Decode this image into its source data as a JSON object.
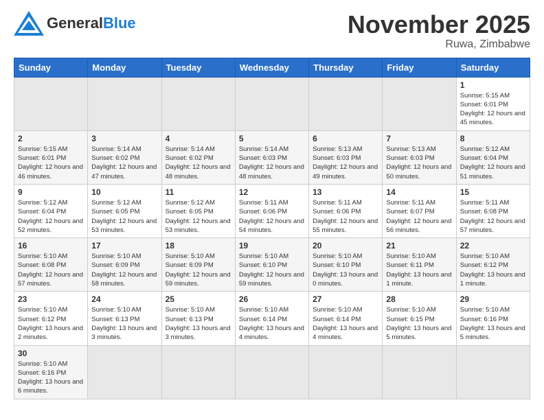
{
  "header": {
    "logo_general": "General",
    "logo_blue": "Blue",
    "month_title": "November 2025",
    "location": "Ruwa, Zimbabwe"
  },
  "weekdays": [
    "Sunday",
    "Monday",
    "Tuesday",
    "Wednesday",
    "Thursday",
    "Friday",
    "Saturday"
  ],
  "weeks": [
    {
      "days": [
        {
          "num": "",
          "empty": true
        },
        {
          "num": "",
          "empty": true
        },
        {
          "num": "",
          "empty": true
        },
        {
          "num": "",
          "empty": true
        },
        {
          "num": "",
          "empty": true
        },
        {
          "num": "",
          "empty": true
        },
        {
          "num": "1",
          "sunrise": "5:15 AM",
          "sunset": "6:01 PM",
          "daylight": "12 hours and 45 minutes."
        }
      ]
    },
    {
      "days": [
        {
          "num": "2",
          "sunrise": "5:15 AM",
          "sunset": "6:01 PM",
          "daylight": "12 hours and 46 minutes."
        },
        {
          "num": "3",
          "sunrise": "5:14 AM",
          "sunset": "6:02 PM",
          "daylight": "12 hours and 47 minutes."
        },
        {
          "num": "4",
          "sunrise": "5:14 AM",
          "sunset": "6:02 PM",
          "daylight": "12 hours and 48 minutes."
        },
        {
          "num": "5",
          "sunrise": "5:14 AM",
          "sunset": "6:03 PM",
          "daylight": "12 hours and 48 minutes."
        },
        {
          "num": "6",
          "sunrise": "5:13 AM",
          "sunset": "6:03 PM",
          "daylight": "12 hours and 49 minutes."
        },
        {
          "num": "7",
          "sunrise": "5:13 AM",
          "sunset": "6:03 PM",
          "daylight": "12 hours and 50 minutes."
        },
        {
          "num": "8",
          "sunrise": "5:12 AM",
          "sunset": "6:04 PM",
          "daylight": "12 hours and 51 minutes."
        }
      ]
    },
    {
      "days": [
        {
          "num": "9",
          "sunrise": "5:12 AM",
          "sunset": "6:04 PM",
          "daylight": "12 hours and 52 minutes."
        },
        {
          "num": "10",
          "sunrise": "5:12 AM",
          "sunset": "6:05 PM",
          "daylight": "12 hours and 53 minutes."
        },
        {
          "num": "11",
          "sunrise": "5:12 AM",
          "sunset": "6:05 PM",
          "daylight": "12 hours and 53 minutes."
        },
        {
          "num": "12",
          "sunrise": "5:11 AM",
          "sunset": "6:06 PM",
          "daylight": "12 hours and 54 minutes."
        },
        {
          "num": "13",
          "sunrise": "5:11 AM",
          "sunset": "6:06 PM",
          "daylight": "12 hours and 55 minutes."
        },
        {
          "num": "14",
          "sunrise": "5:11 AM",
          "sunset": "6:07 PM",
          "daylight": "12 hours and 56 minutes."
        },
        {
          "num": "15",
          "sunrise": "5:11 AM",
          "sunset": "6:08 PM",
          "daylight": "12 hours and 57 minutes."
        }
      ]
    },
    {
      "days": [
        {
          "num": "16",
          "sunrise": "5:10 AM",
          "sunset": "6:08 PM",
          "daylight": "12 hours and 57 minutes."
        },
        {
          "num": "17",
          "sunrise": "5:10 AM",
          "sunset": "6:09 PM",
          "daylight": "12 hours and 58 minutes."
        },
        {
          "num": "18",
          "sunrise": "5:10 AM",
          "sunset": "6:09 PM",
          "daylight": "12 hours and 59 minutes."
        },
        {
          "num": "19",
          "sunrise": "5:10 AM",
          "sunset": "6:10 PM",
          "daylight": "12 hours and 59 minutes."
        },
        {
          "num": "20",
          "sunrise": "5:10 AM",
          "sunset": "6:10 PM",
          "daylight": "13 hours and 0 minutes."
        },
        {
          "num": "21",
          "sunrise": "5:10 AM",
          "sunset": "6:11 PM",
          "daylight": "13 hours and 1 minute."
        },
        {
          "num": "22",
          "sunrise": "5:10 AM",
          "sunset": "6:12 PM",
          "daylight": "13 hours and 1 minute."
        }
      ]
    },
    {
      "days": [
        {
          "num": "23",
          "sunrise": "5:10 AM",
          "sunset": "6:12 PM",
          "daylight": "13 hours and 2 minutes."
        },
        {
          "num": "24",
          "sunrise": "5:10 AM",
          "sunset": "6:13 PM",
          "daylight": "13 hours and 3 minutes."
        },
        {
          "num": "25",
          "sunrise": "5:10 AM",
          "sunset": "6:13 PM",
          "daylight": "13 hours and 3 minutes."
        },
        {
          "num": "26",
          "sunrise": "5:10 AM",
          "sunset": "6:14 PM",
          "daylight": "13 hours and 4 minutes."
        },
        {
          "num": "27",
          "sunrise": "5:10 AM",
          "sunset": "6:14 PM",
          "daylight": "13 hours and 4 minutes."
        },
        {
          "num": "28",
          "sunrise": "5:10 AM",
          "sunset": "6:15 PM",
          "daylight": "13 hours and 5 minutes."
        },
        {
          "num": "29",
          "sunrise": "5:10 AM",
          "sunset": "6:16 PM",
          "daylight": "13 hours and 5 minutes."
        }
      ]
    },
    {
      "days": [
        {
          "num": "30",
          "sunrise": "5:10 AM",
          "sunset": "6:16 PM",
          "daylight": "13 hours and 6 minutes."
        },
        {
          "num": "",
          "empty": true
        },
        {
          "num": "",
          "empty": true
        },
        {
          "num": "",
          "empty": true
        },
        {
          "num": "",
          "empty": true
        },
        {
          "num": "",
          "empty": true
        },
        {
          "num": "",
          "empty": true
        }
      ]
    }
  ],
  "labels": {
    "sunrise": "Sunrise:",
    "sunset": "Sunset:",
    "daylight": "Daylight:"
  }
}
